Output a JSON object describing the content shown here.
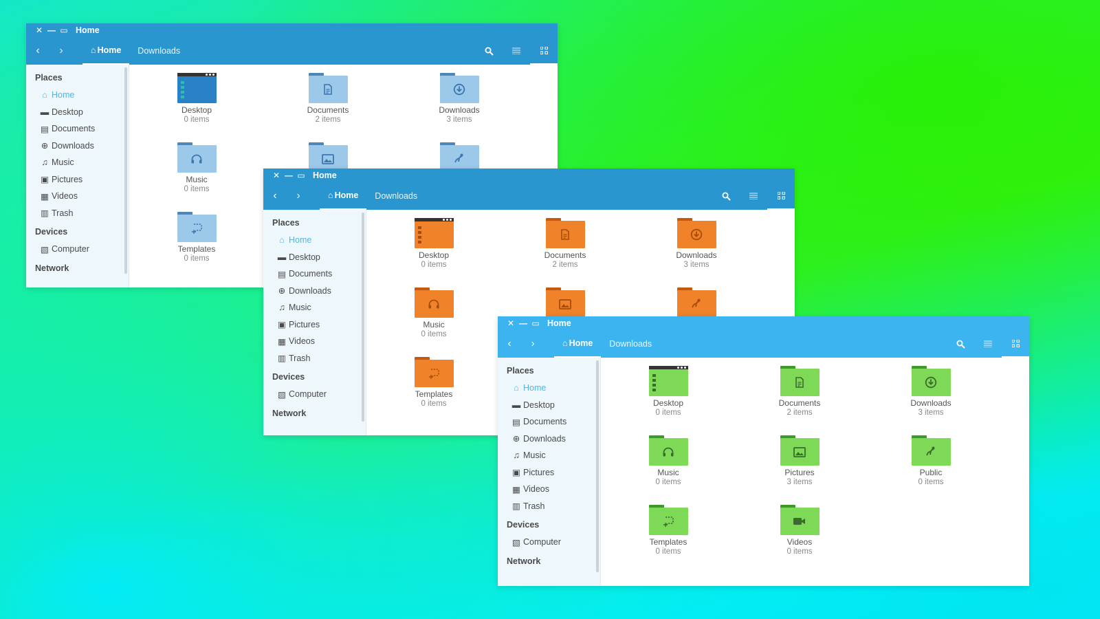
{
  "windows": [
    {
      "title": "Home",
      "theme": {
        "bar": "#2a96d0",
        "folder": "#9cc8ea",
        "folder_tab": "#4f86b8",
        "glyph": "#3b76b0",
        "desk_body": "#2a82c6",
        "desk_side": "#27c4a0"
      },
      "nav": {
        "back": "‹",
        "forward": "›"
      },
      "breadcrumbs": [
        {
          "label": "Home",
          "active": true
        },
        {
          "label": "Downloads",
          "active": false
        }
      ],
      "sidebar": {
        "places_label": "Places",
        "items": [
          {
            "label": "Home",
            "icon": "home-icon",
            "glyph": "⌂",
            "selected": true
          },
          {
            "label": "Desktop",
            "icon": "desktop-icon",
            "glyph": "▬"
          },
          {
            "label": "Documents",
            "icon": "document-icon",
            "glyph": "▤"
          },
          {
            "label": "Downloads",
            "icon": "download-icon",
            "glyph": "⊕"
          },
          {
            "label": "Music",
            "icon": "music-icon",
            "glyph": "♫"
          },
          {
            "label": "Pictures",
            "icon": "pictures-icon",
            "glyph": "▣"
          },
          {
            "label": "Videos",
            "icon": "videos-icon",
            "glyph": "▦"
          },
          {
            "label": "Trash",
            "icon": "trash-icon",
            "glyph": "▥"
          }
        ],
        "devices_label": "Devices",
        "devices": [
          {
            "label": "Computer",
            "icon": "computer-icon",
            "glyph": "▧"
          }
        ],
        "network_label": "Network"
      },
      "files": [
        {
          "name": "Desktop",
          "count": "0 items",
          "kind": "desktop"
        },
        {
          "name": "Documents",
          "count": "2 items",
          "kind": "documents"
        },
        {
          "name": "Downloads",
          "count": "3 items",
          "kind": "downloads"
        },
        {
          "name": "Music",
          "count": "0 items",
          "kind": "music"
        },
        {
          "name": "Pictures",
          "count": "",
          "kind": "pictures"
        },
        {
          "name": "Public",
          "count": "",
          "kind": "public"
        },
        {
          "name": "Templates",
          "count": "0 items",
          "kind": "templates"
        }
      ]
    },
    {
      "title": "Home",
      "theme": {
        "bar": "#2a96d0",
        "folder": "#f0822a",
        "folder_tab": "#c45a12",
        "glyph": "#a84c0c",
        "desk_body": "#f0822a",
        "desk_side": "#a84c0c"
      },
      "nav": {
        "back": "‹",
        "forward": "›"
      },
      "breadcrumbs": [
        {
          "label": "Home",
          "active": true
        },
        {
          "label": "Downloads",
          "active": false
        }
      ],
      "sidebar": {
        "places_label": "Places",
        "items": [
          {
            "label": "Home",
            "icon": "home-icon",
            "glyph": "⌂",
            "selected": true
          },
          {
            "label": "Desktop",
            "icon": "desktop-icon",
            "glyph": "▬"
          },
          {
            "label": "Documents",
            "icon": "document-icon",
            "glyph": "▤"
          },
          {
            "label": "Downloads",
            "icon": "download-icon",
            "glyph": "⊕"
          },
          {
            "label": "Music",
            "icon": "music-icon",
            "glyph": "♫"
          },
          {
            "label": "Pictures",
            "icon": "pictures-icon",
            "glyph": "▣"
          },
          {
            "label": "Videos",
            "icon": "videos-icon",
            "glyph": "▦"
          },
          {
            "label": "Trash",
            "icon": "trash-icon",
            "glyph": "▥"
          }
        ],
        "devices_label": "Devices",
        "devices": [
          {
            "label": "Computer",
            "icon": "computer-icon",
            "glyph": "▧"
          }
        ],
        "network_label": "Network"
      },
      "files": [
        {
          "name": "Desktop",
          "count": "0 items",
          "kind": "desktop"
        },
        {
          "name": "Documents",
          "count": "2 items",
          "kind": "documents"
        },
        {
          "name": "Downloads",
          "count": "3 items",
          "kind": "downloads"
        },
        {
          "name": "Music",
          "count": "0 items",
          "kind": "music"
        },
        {
          "name": "Pictures",
          "count": "",
          "kind": "pictures"
        },
        {
          "name": "Public",
          "count": "",
          "kind": "public"
        },
        {
          "name": "Templates",
          "count": "0 items",
          "kind": "templates"
        }
      ]
    },
    {
      "title": "Home",
      "theme": {
        "bar": "#3bb4f0",
        "folder": "#7ed957",
        "folder_tab": "#3d9a2a",
        "glyph": "#3a6b2c",
        "desk_body": "#7ed957",
        "desk_side": "#3a6b2c"
      },
      "nav": {
        "back": "‹",
        "forward": "›"
      },
      "breadcrumbs": [
        {
          "label": "Home",
          "active": true
        },
        {
          "label": "Downloads",
          "active": false
        }
      ],
      "sidebar": {
        "places_label": "Places",
        "items": [
          {
            "label": "Home",
            "icon": "home-icon",
            "glyph": "⌂",
            "selected": true
          },
          {
            "label": "Desktop",
            "icon": "desktop-icon",
            "glyph": "▬"
          },
          {
            "label": "Documents",
            "icon": "document-icon",
            "glyph": "▤"
          },
          {
            "label": "Downloads",
            "icon": "download-icon",
            "glyph": "⊕"
          },
          {
            "label": "Music",
            "icon": "music-icon",
            "glyph": "♫"
          },
          {
            "label": "Pictures",
            "icon": "pictures-icon",
            "glyph": "▣"
          },
          {
            "label": "Videos",
            "icon": "videos-icon",
            "glyph": "▦"
          },
          {
            "label": "Trash",
            "icon": "trash-icon",
            "glyph": "▥"
          }
        ],
        "devices_label": "Devices",
        "devices": [
          {
            "label": "Computer",
            "icon": "computer-icon",
            "glyph": "▧"
          }
        ],
        "network_label": "Network"
      },
      "files": [
        {
          "name": "Desktop",
          "count": "0 items",
          "kind": "desktop"
        },
        {
          "name": "Documents",
          "count": "2 items",
          "kind": "documents"
        },
        {
          "name": "Downloads",
          "count": "3 items",
          "kind": "downloads"
        },
        {
          "name": "Music",
          "count": "0 items",
          "kind": "music"
        },
        {
          "name": "Pictures",
          "count": "3 items",
          "kind": "pictures"
        },
        {
          "name": "Public",
          "count": "0 items",
          "kind": "public"
        },
        {
          "name": "Templates",
          "count": "0 items",
          "kind": "templates"
        },
        {
          "name": "Videos",
          "count": "0 items",
          "kind": "videos"
        }
      ]
    }
  ]
}
